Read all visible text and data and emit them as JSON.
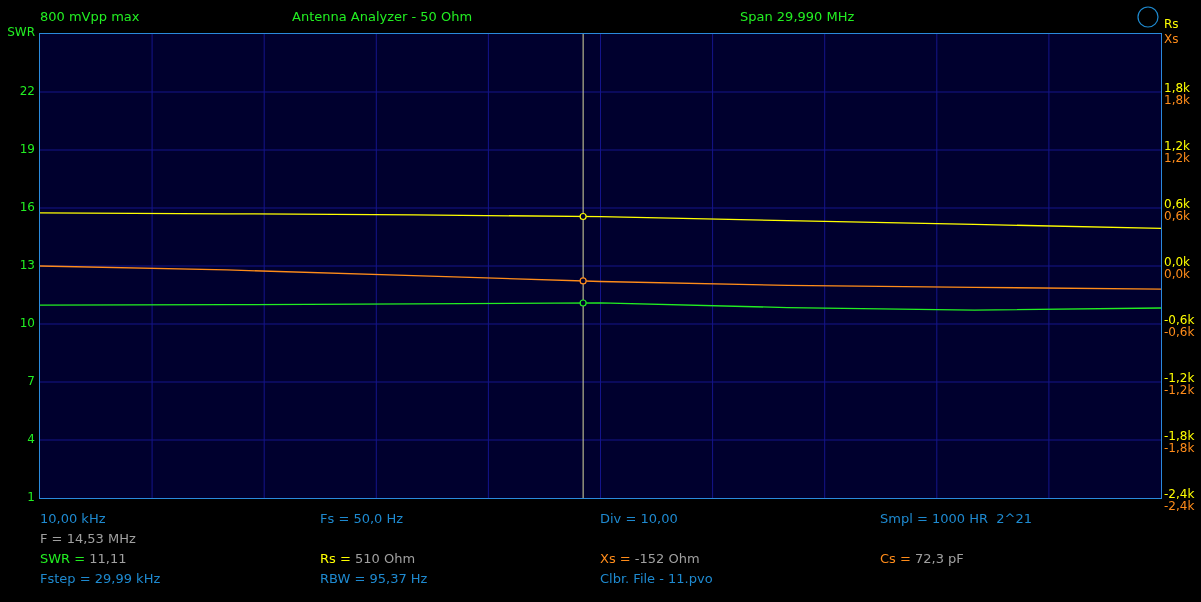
{
  "header": [
    "800 mVpp max",
    "Antenna Analyzer - 50 Ohm",
    "Span 29,990 MHz"
  ],
  "plot": {
    "cursor": {
      "level": 0.4845
    },
    "swr": {
      "chart_data": {
        "type": "line",
        "grid": true,
        "categories": [
          null,
          null,
          null,
          null,
          null,
          null,
          null
        ],
        "ylim": [
          1,
          25
        ],
        "yticks": [
          {
            "value": 1,
            "label": "1"
          },
          {
            "value": 4,
            "label": "4"
          },
          {
            "value": 7,
            "label": "7"
          },
          {
            "value": 10,
            "label": "10"
          },
          {
            "value": 13,
            "label": "13"
          },
          {
            "value": 16,
            "label": "16"
          },
          {
            "value": 19,
            "label": "19"
          },
          {
            "value": 22,
            "label": "22"
          }
        ],
        "series": [
          {
            "name": "SWR",
            "color": "#22ee22",
            "values": [
              10.98,
              11.0,
              11.04,
              11.09,
              10.85,
              10.72,
              10.83
            ]
          }
        ]
      }
    },
    "impedance": {
      "chart_data": {
        "type": "line",
        "categories": [
          null,
          null,
          null,
          null,
          null,
          null,
          null
        ],
        "ylim": [
          -2.4,
          2.4
        ],
        "yticks": [
          {
            "value": 1.8,
            "label": "1,8k"
          },
          {
            "value": 1.2,
            "label": "1,2k"
          },
          {
            "value": 0.6,
            "label": "0,6k"
          },
          {
            "value": 0,
            "label": "0,0k"
          },
          {
            "value": -0.6,
            "label": "-0,6k"
          },
          {
            "value": -1.2,
            "label": "-1,2k"
          },
          {
            "value": -1.8,
            "label": "-1,8k"
          },
          {
            "value": -2.4,
            "label": "-2,4k"
          }
        ],
        "series": [
          {
            "name": "Rs",
            "color": "#ffff00",
            "values": [
              0.55,
              0.54,
              0.53,
              0.51,
              0.47,
              0.43,
              0.39
            ]
          },
          {
            "name": "Xs",
            "color": "#ff8c1a",
            "values": [
              0,
              -0.04,
              -0.1,
              -0.16,
              -0.2,
              -0.22,
              -0.24
            ]
          }
        ]
      },
      "xs_axis_labels": [
        "1,8k",
        "1,2k",
        "0,6k",
        "0,0k",
        "-0,6k",
        "-1,2k",
        "-1,8k",
        "-2,4k"
      ]
    }
  },
  "readouts": [
    [
      {
        "kind": "setting",
        "text": "10,00 kHz"
      },
      {
        "kind": "setting",
        "text": "Fs = 50,0 Hz"
      },
      {
        "kind": "setting",
        "text": "Div = 10,00"
      },
      {
        "kind": "setting",
        "text": "Smpl = 1000 HR  2^21"
      }
    ],
    [
      {
        "kind": "reading",
        "text": "F = 14,53 MHz"
      }
    ],
    [
      {
        "kind": "measure",
        "label": "SWR =",
        "value": "11,11",
        "color": "#22ee22"
      },
      {
        "kind": "measure",
        "label": "Rs =",
        "value": "510 Ohm",
        "color": "#ffff00"
      },
      {
        "kind": "measure",
        "label": "Xs =",
        "value": "-152 Ohm",
        "color": "#ff8c1a"
      },
      {
        "kind": "measure",
        "label": "Cs =",
        "value": "72,3 pF",
        "color": "#ff8c1a"
      }
    ],
    [
      {
        "kind": "setting",
        "text": "Fstep = 29,99 kHz"
      },
      {
        "kind": "setting",
        "text": "RBW = 95,37 Hz"
      },
      {
        "kind": "setting",
        "text": "Clbr. File - 11.pvo"
      }
    ]
  ]
}
